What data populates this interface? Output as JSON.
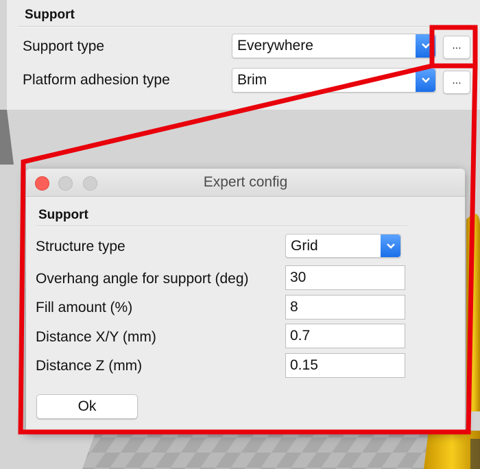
{
  "settings_panel": {
    "section_title": "Support",
    "rows": [
      {
        "label": "Support type",
        "value": "Everywhere",
        "button": "..."
      },
      {
        "label": "Platform adhesion type",
        "value": "Brim",
        "button": "..."
      }
    ]
  },
  "dialog": {
    "title": "Expert config",
    "section_title": "Support",
    "structure_type": {
      "label": "Structure type",
      "value": "Grid"
    },
    "fields": [
      {
        "label": "Overhang angle for support (deg)",
        "value": "30"
      },
      {
        "label": "Fill amount (%)",
        "value": "8"
      },
      {
        "label": "Distance X/Y (mm)",
        "value": "0.7"
      },
      {
        "label": "Distance Z (mm)",
        "value": "0.15"
      }
    ],
    "ok_label": "Ok"
  },
  "colors": {
    "callout": "#e8000b",
    "select_accent": "#2a7df0",
    "traffic_close": "#fc5f57",
    "traffic_inactive": "#d0d0d0",
    "model_yellow": "#e8b400"
  }
}
